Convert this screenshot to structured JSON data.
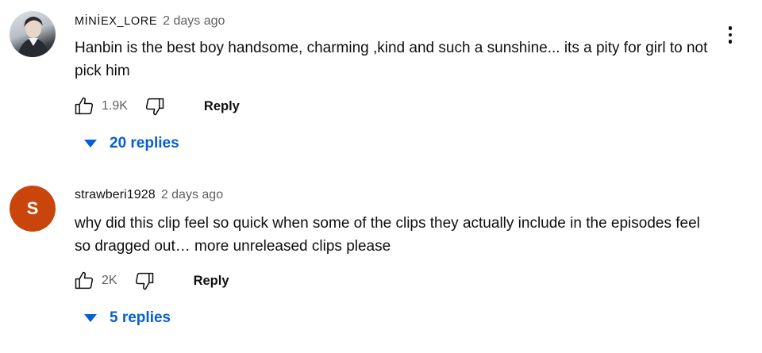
{
  "comments": [
    {
      "username": "MİNİEX_LORE",
      "timestamp": "2 days ago",
      "avatar_icon": "user-photo-avatar",
      "text": "Hanbin is the best boy handsome, charming ,kind and such a sunshine...  its a pity for girl to not pick him",
      "likes": "1.9K",
      "reply_label": "Reply",
      "replies_label": "20 replies",
      "has_more_menu": true
    },
    {
      "username": "strawberi1928",
      "timestamp": "2 days ago",
      "avatar_letter": "S",
      "avatar_color": "#c9450c",
      "text": "why did this clip feel so quick when some of the clips they actually include in the episodes feel so dragged out… more unreleased clips please",
      "likes": "2K",
      "reply_label": "Reply",
      "replies_label": "5 replies"
    }
  ],
  "colors": {
    "link_blue": "#065fd4",
    "secondary_text": "#606060",
    "primary_text": "#0f0f0f"
  }
}
